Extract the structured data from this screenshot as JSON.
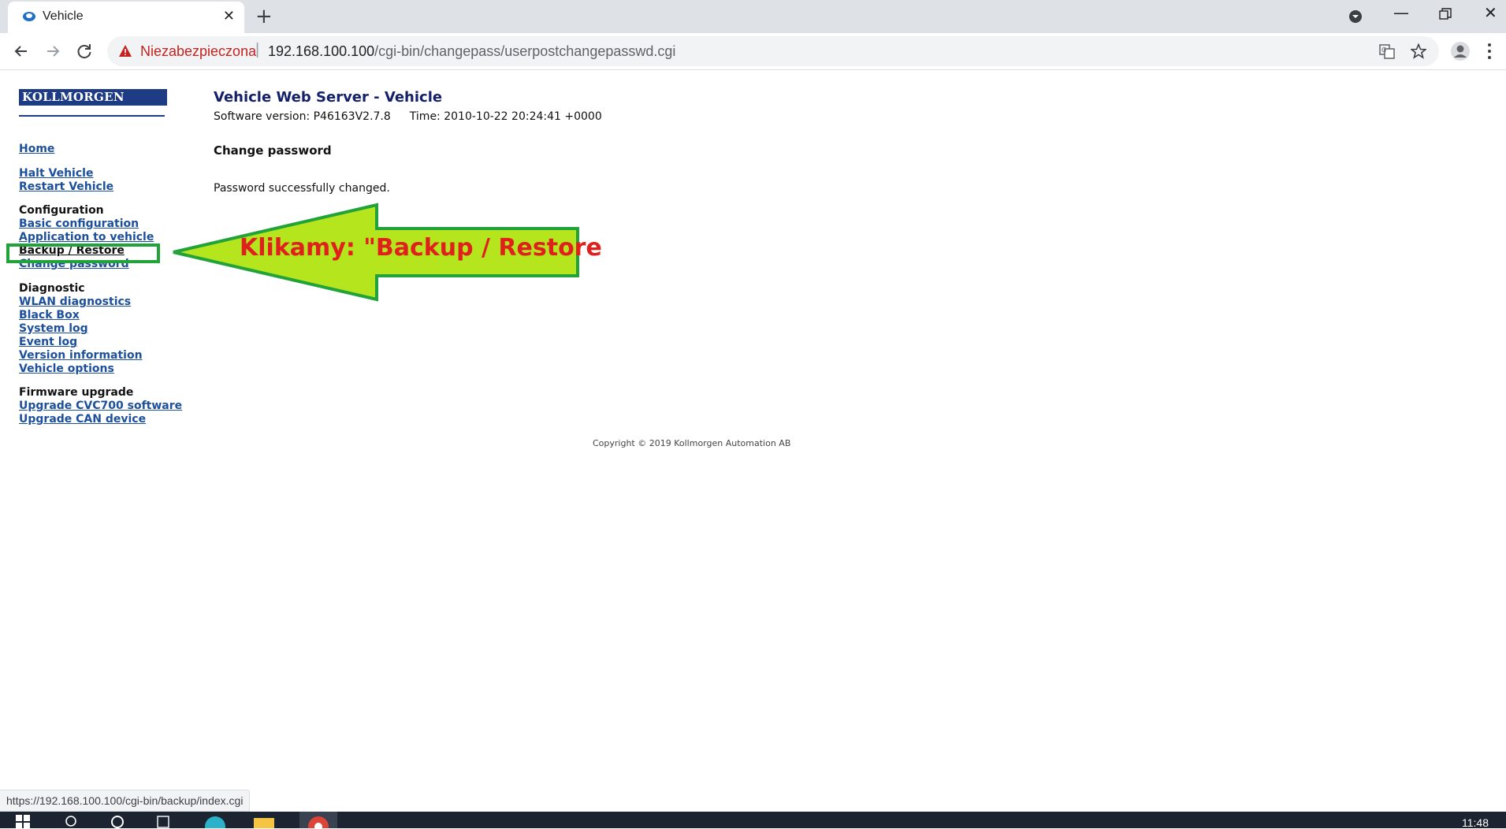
{
  "browser": {
    "tab_title": "Vehicle",
    "security_label": "Niezabezpieczona",
    "url_host": "192.168.100.100",
    "url_path": "/cgi-bin/changepass/userpostchangepasswd.cgi",
    "status_url": "https://192.168.100.100/cgi-bin/backup/index.cgi"
  },
  "logo": {
    "text": "KOLLMORGEN"
  },
  "header": {
    "title": "Vehicle Web Server - Vehicle",
    "software_version": "Software version: P46163V2.7.8",
    "time": "Time: 2010-10-22 20:24:41 +0000"
  },
  "nav": {
    "home": "Home",
    "halt": "Halt Vehicle",
    "restart": "Restart Vehicle",
    "configuration": "Configuration",
    "basic_config": "Basic configuration",
    "application": "Application to vehicle",
    "backup": "Backup / Restore",
    "change_password": "Change password",
    "diagnostic": "Diagnostic",
    "wlan": "WLAN diagnostics",
    "black_box": "Black Box",
    "system_log": "System log",
    "event_log": "Event log",
    "version": "Version information",
    "vehicle_options": "Vehicle options",
    "firmware": "Firmware upgrade",
    "upgrade_cvc": "Upgrade CVC700 software",
    "upgrade_can": "Upgrade CAN device"
  },
  "main": {
    "section_title": "Change password",
    "message": "Password successfully changed."
  },
  "footer": {
    "copyright": "Copyright © 2019 Kollmorgen Automation AB"
  },
  "annotation": {
    "text": "Klikamy: \"Backup / Restore"
  },
  "taskbar": {
    "clock": "11:48"
  },
  "colors": {
    "link": "#1c4f9c",
    "title": "#14206a",
    "logo_bg": "#1e3c84",
    "annotation_green": "#22a33a",
    "arrow_fill": "#b5e61d",
    "annotation_text": "#e0201c",
    "insecure_red": "#c5221f"
  }
}
